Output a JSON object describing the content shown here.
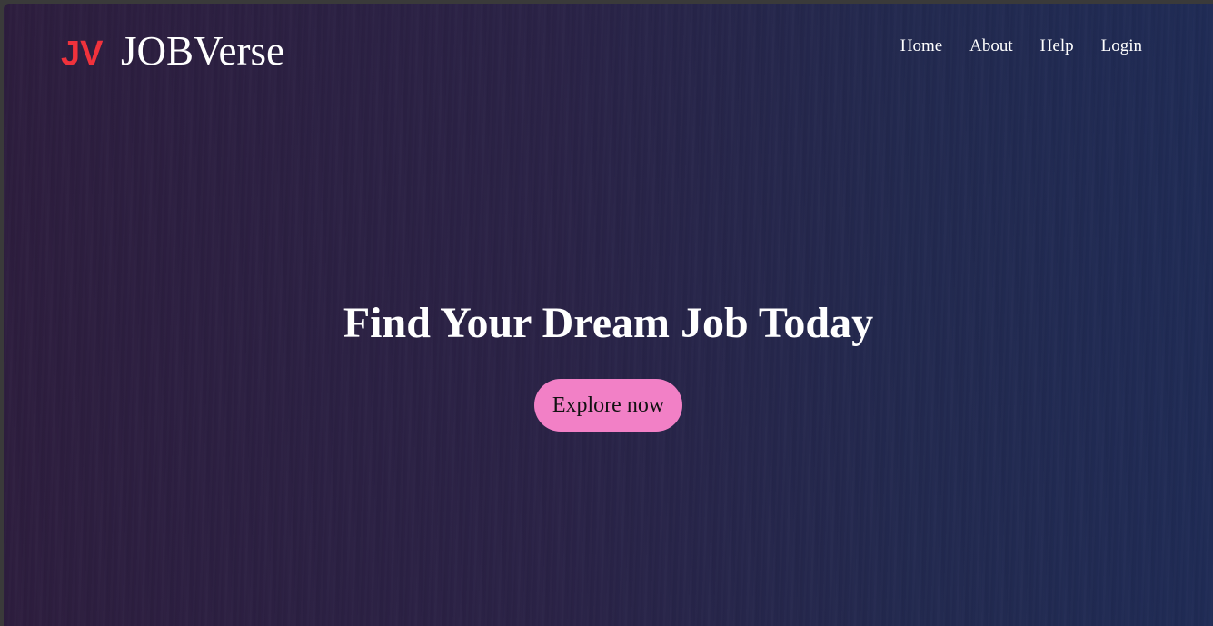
{
  "brand": {
    "logo_mark_text": "JV",
    "name": "JOBVerse",
    "logo_color": "#f0323c"
  },
  "nav": {
    "items": [
      {
        "label": "Home"
      },
      {
        "label": "About"
      },
      {
        "label": "Help"
      },
      {
        "label": "Login"
      }
    ]
  },
  "hero": {
    "title": "Find Your Dream Job Today",
    "cta_label": "Explore now",
    "cta_color": "#f280c6"
  },
  "theme": {
    "background_left": "#2d1d3e",
    "background_right": "#1f2b55",
    "text_color": "#ffffff"
  }
}
